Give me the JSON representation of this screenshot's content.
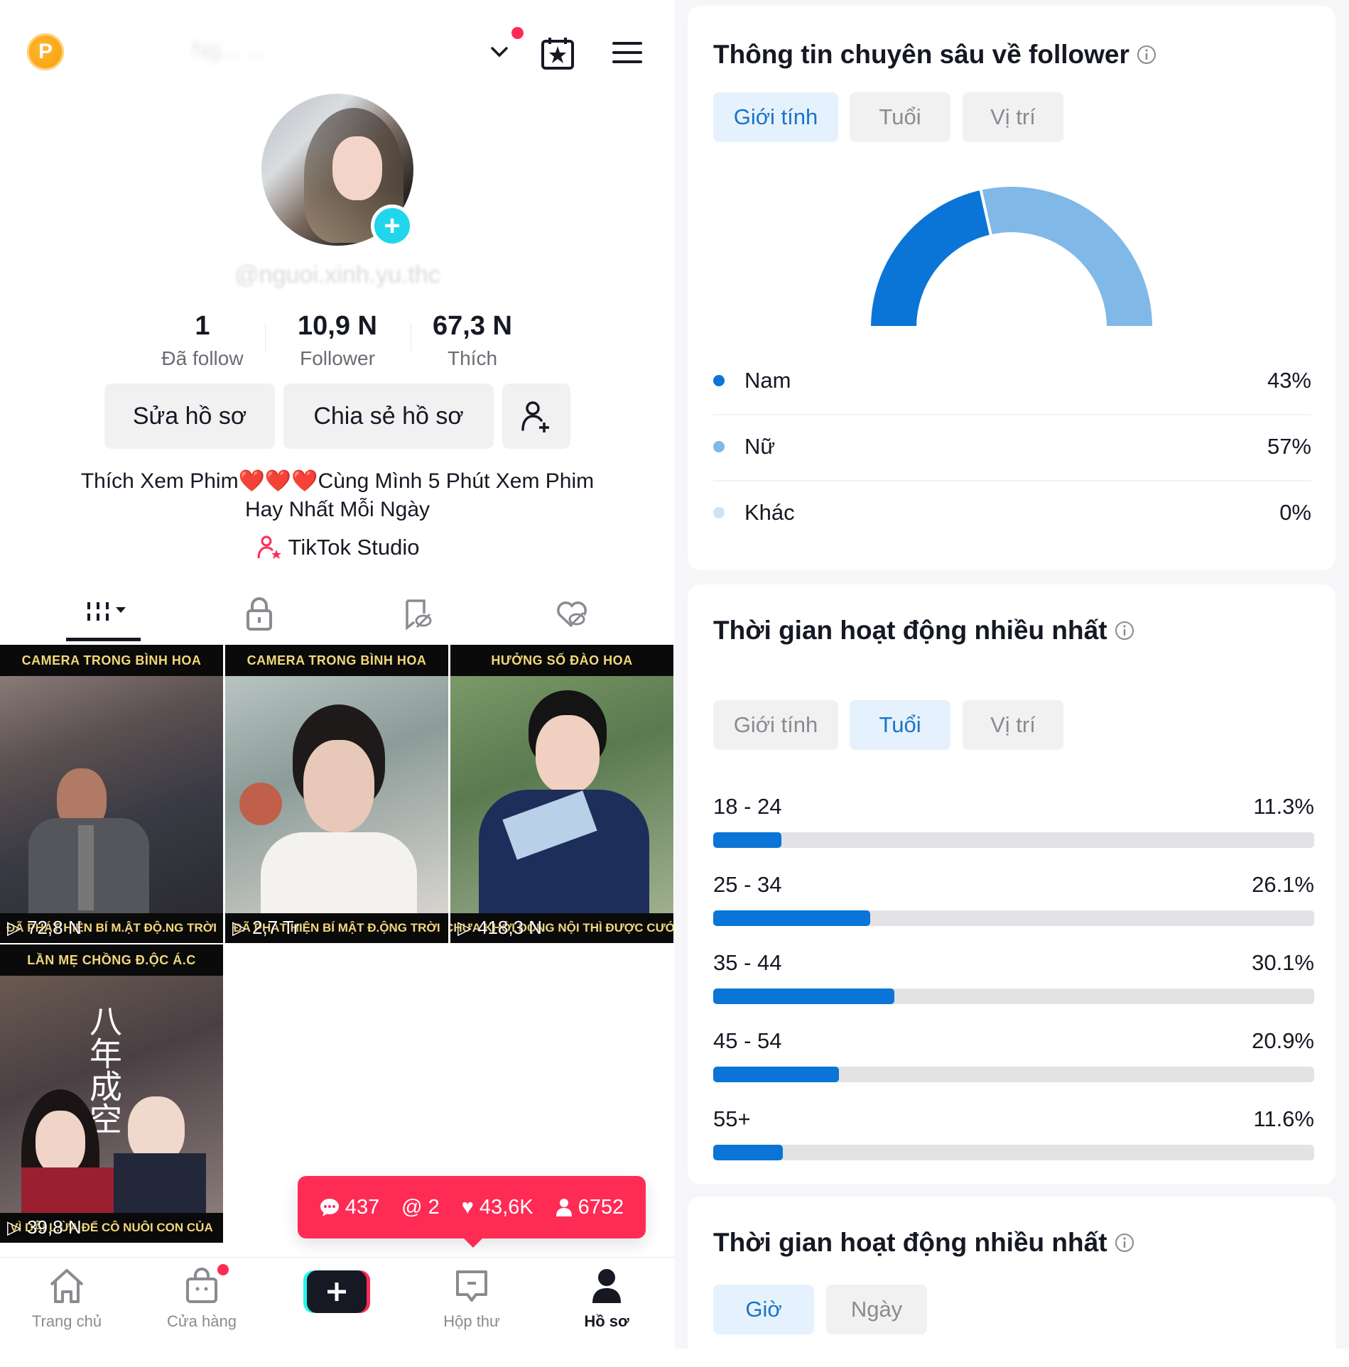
{
  "profile": {
    "coin_icon": "P",
    "account_name_blurred": "Ng... ...",
    "username": "@nguoi.xinh.yu.thc",
    "stats": [
      {
        "value": "1",
        "label": "Đã follow"
      },
      {
        "value": "10,9 N",
        "label": "Follower"
      },
      {
        "value": "67,3 N",
        "label": "Thích"
      }
    ],
    "buttons": {
      "edit": "Sửa hồ sơ",
      "share": "Chia sẻ hồ sơ"
    },
    "bio_line1": "Thích Xem Phim❤️❤️❤️Cùng Mình 5 Phút Xem Phim",
    "bio_line2": "Hay Nhất Mỗi Ngày",
    "studio_label": "TikTok Studio"
  },
  "content_tabs": [
    "videos",
    "private",
    "saved",
    "liked"
  ],
  "videos": [
    {
      "top": "CAMERA TRONG BÌNH HOA",
      "bottom": "ĐÃ PHÁT HIỆN BÍ M.ẬT ĐỘ.NG TRỜI",
      "views": "72,8 N"
    },
    {
      "top": "CAMERA TRONG BÌNH HOA",
      "bottom": "ĐÃ PHÁT HIỆN BÍ MẬT Đ.ỘNG TRỜI",
      "views": "2,7 Tr"
    },
    {
      "top": "HƯỞNG SỐ ĐÀO HOA",
      "bottom": "CHƯA KHỞI ĐỘNG NỘI THÌ ĐƯỢC CƯỚI",
      "views": "418,3 N"
    },
    {
      "top": "LẦN MẸ CHỒNG Đ.ỘC Á.C",
      "bottom": "VÌ DÃ̉I L.ỪA ĐỂ CÔ NUÔI CON CỦA",
      "views": "39,8 N",
      "overlay_text": "八年成空"
    }
  ],
  "notification_bubble": {
    "comments": "437",
    "mentions": "2",
    "likes": "43,6K",
    "followers": "6752"
  },
  "bottom_nav": [
    {
      "label": "Trang chủ",
      "icon": "home-icon"
    },
    {
      "label": "Cửa hàng",
      "icon": "shop-icon"
    },
    {
      "label": "",
      "icon": "create-icon"
    },
    {
      "label": "Hộp thư",
      "icon": "inbox-icon"
    },
    {
      "label": "Hồ sơ",
      "icon": "profile-icon",
      "active": true
    }
  ],
  "insights": {
    "title": "Thông tin chuyên sâu về follower",
    "segments": [
      "Giới tính",
      "Tuổi",
      "Vị trí"
    ],
    "active_segment": "Giới tính",
    "colors": {
      "male": "#0a75d6",
      "female": "#80b8e8",
      "other": "#cfe3f5"
    }
  },
  "active_time_card": {
    "title": "Thời gian hoạt động nhiều nhất",
    "segments": [
      "Giới tính",
      "Tuổi",
      "Vị trí"
    ],
    "active_segment": "Tuổi"
  },
  "active_time_card2": {
    "title": "Thời gian hoạt động nhiều nhất",
    "segments": [
      "Giờ",
      "Ngày"
    ],
    "active_segment": "Giờ"
  },
  "chart_data": [
    {
      "type": "pie",
      "title": "Giới tính",
      "style": "semi-donut",
      "categories": [
        "Nam",
        "Nữ",
        "Khác"
      ],
      "values": [
        43,
        57,
        0
      ],
      "labels": [
        "43%",
        "57%",
        "0%"
      ]
    },
    {
      "type": "bar",
      "title": "Tuổi",
      "orientation": "horizontal",
      "categories": [
        "18 - 24",
        "25 - 34",
        "35 - 44",
        "45 - 54",
        "55+"
      ],
      "values": [
        11.3,
        26.1,
        30.1,
        20.9,
        11.6
      ],
      "labels": [
        "11.3%",
        "26.1%",
        "30.1%",
        "20.9%",
        "11.6%"
      ],
      "xlim": [
        0,
        100
      ]
    }
  ]
}
